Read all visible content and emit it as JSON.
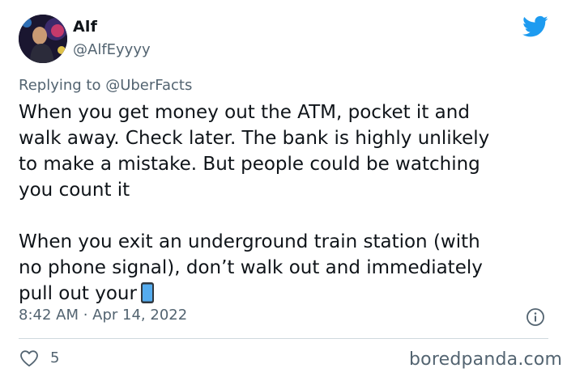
{
  "author": {
    "name": "Alf",
    "handle": "@AlfEyyyy"
  },
  "reply": {
    "prefix": "Replying to ",
    "mention": "@UberFacts"
  },
  "body": {
    "paragraph1": [
      "When you get money out the ATM, pocket it and",
      "walk away. Check later. The bank is highly unlikely",
      "to make a mistake. But people could be watching",
      "you count it"
    ],
    "paragraph2": [
      "When you exit an underground train station (with",
      "no phone signal), don’t walk out and immediately",
      "pull out your"
    ],
    "emoji": "mobile-phone-emoji"
  },
  "timestamp": "8:42 AM · Apr 14, 2022",
  "actions": {
    "likes": "5"
  },
  "watermark": "boredpanda.com",
  "icons": {
    "brand": "twitter-bird-icon",
    "info": "info-icon",
    "like": "heart-icon"
  },
  "colors": {
    "twitter_blue": "#1d9bf0",
    "text_primary": "#0f1419",
    "text_secondary": "#536471",
    "divider": "#cfd9de"
  }
}
